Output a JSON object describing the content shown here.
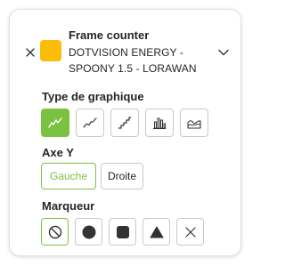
{
  "header": {
    "title": "Frame counter",
    "subtitle_line1": "DOTVISION ENERGY -",
    "subtitle_line2": "SPOONY 1.5 - LORAWAN",
    "swatch_color": "#fbbd08"
  },
  "chart_type": {
    "label": "Type de graphique",
    "selected": "line",
    "options": [
      "line-icon",
      "smooth-line-icon",
      "step-line-icon",
      "bar-chart-icon",
      "area-chart-icon"
    ]
  },
  "y_axis": {
    "label": "Axe Y",
    "selected": "left",
    "left_label": "Gauche",
    "right_label": "Droite"
  },
  "marker": {
    "label": "Marqueur",
    "selected": "none",
    "options": [
      "no-marker-icon",
      "circle-marker-icon",
      "square-marker-icon",
      "triangle-marker-icon",
      "cross-marker-icon"
    ]
  },
  "colors": {
    "accent": "#7cc242",
    "border": "#c9c9c9",
    "text": "#262626"
  }
}
